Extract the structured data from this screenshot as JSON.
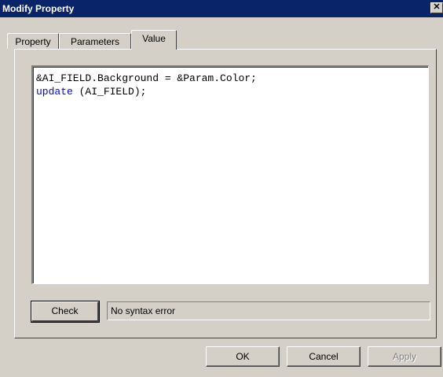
{
  "window": {
    "title": "Modify Property",
    "close_glyph": "✕"
  },
  "tabs": [
    {
      "label": "Property",
      "active": false
    },
    {
      "label": "Parameters",
      "active": false
    },
    {
      "label": "Value",
      "active": true
    }
  ],
  "editor": {
    "lines": [
      {
        "text": "&AI_FIELD.Background = &Param.Color;"
      },
      {
        "keyword": "update",
        "text": " (AI_FIELD);"
      }
    ]
  },
  "check": {
    "button_label": "Check",
    "status_text": "No syntax error"
  },
  "footer": {
    "ok_label": "OK",
    "cancel_label": "Cancel",
    "apply_label": "Apply"
  },
  "colors": {
    "titlebar": "#0a246a",
    "face": "#d4d0c8",
    "keyword": "#0000ff"
  }
}
